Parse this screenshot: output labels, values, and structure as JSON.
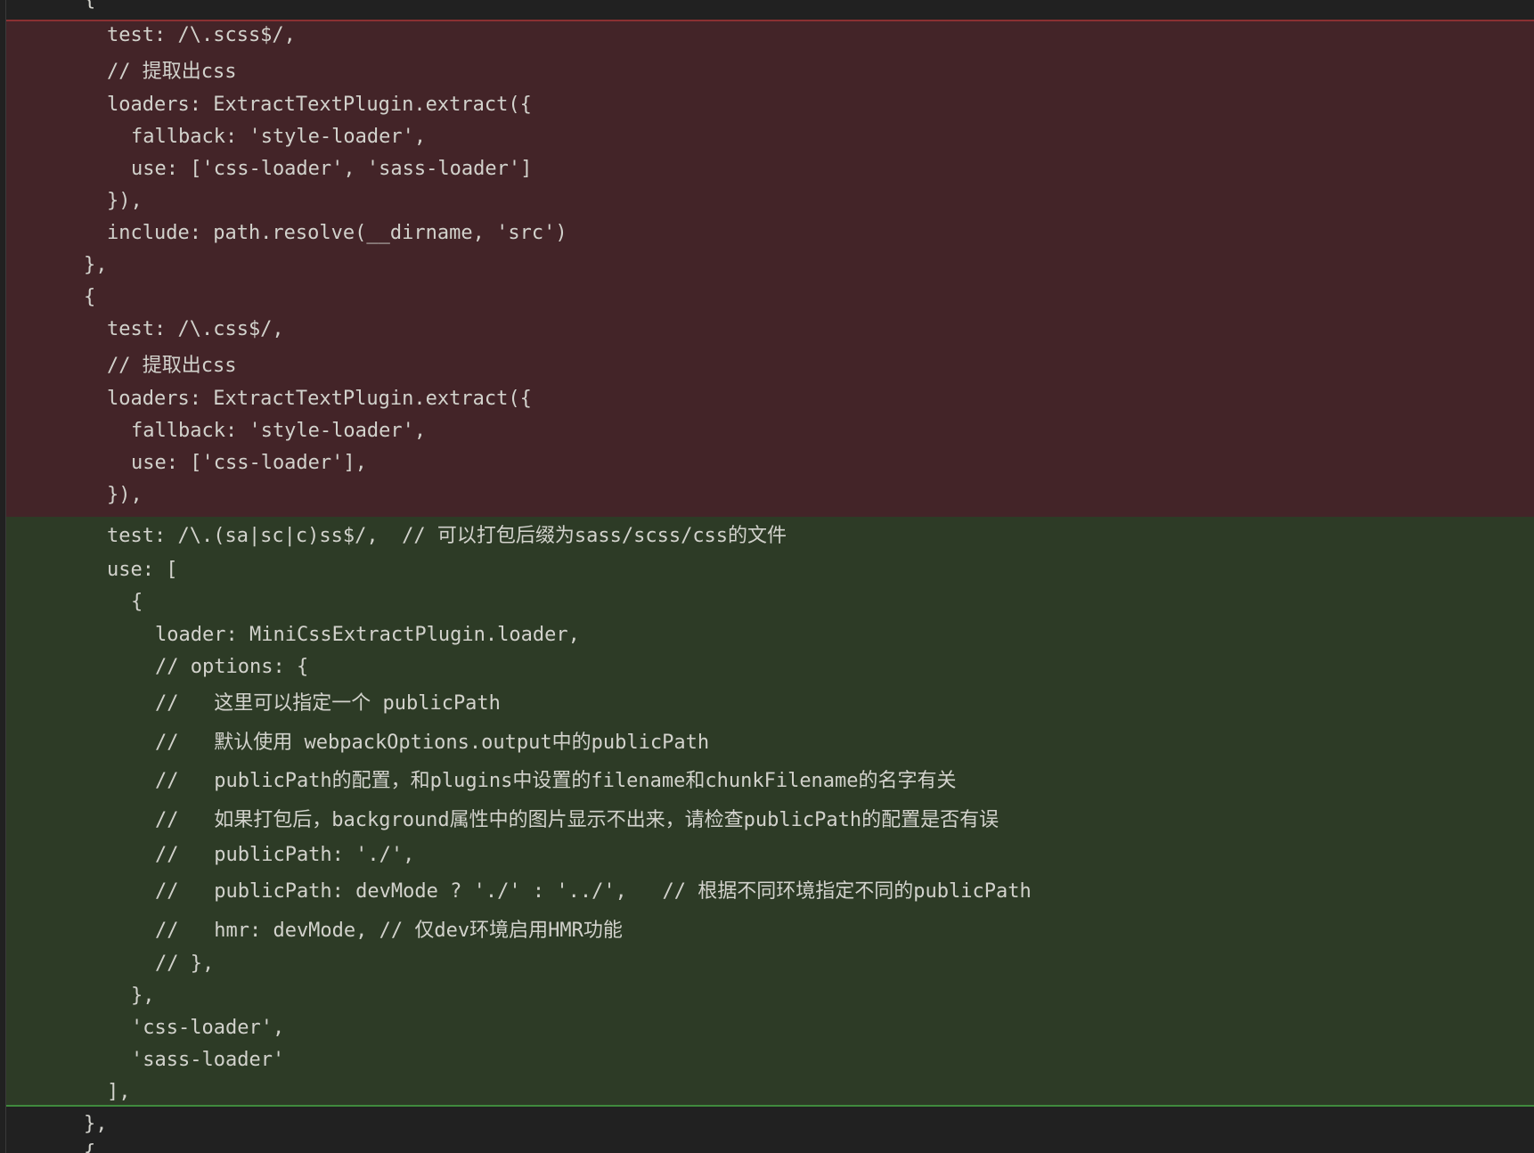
{
  "editor": {
    "context_top": [
      "{"
    ],
    "removed_lines": [
      {
        "indent": 2,
        "text": "test: /\\.scss$/,"
      },
      {
        "indent": 2,
        "text": "// 提取出css"
      },
      {
        "indent": 2,
        "text": "loaders: ExtractTextPlugin.extract({"
      },
      {
        "indent": 3,
        "text": "fallback: 'style-loader',"
      },
      {
        "indent": 3,
        "text": "use: ['css-loader', 'sass-loader']"
      },
      {
        "indent": 2,
        "text": "}),"
      },
      {
        "indent": 2,
        "text": "include: path.resolve(__dirname, 'src')"
      },
      {
        "indent": 1,
        "text": "},"
      },
      {
        "indent": 1,
        "text": "{"
      },
      {
        "indent": 2,
        "text": "test: /\\.css$/,"
      },
      {
        "indent": 2,
        "text": "// 提取出css"
      },
      {
        "indent": 2,
        "text": "loaders: ExtractTextPlugin.extract({"
      },
      {
        "indent": 3,
        "text": "fallback: 'style-loader',"
      },
      {
        "indent": 3,
        "text": "use: ['css-loader'],"
      },
      {
        "indent": 2,
        "text": "}),"
      }
    ],
    "added_lines": [
      {
        "indent": 2,
        "text": "test: /\\.(sa|sc|c)ss$/,  // 可以打包后缀为sass/scss/css的文件"
      },
      {
        "indent": 2,
        "text": "use: ["
      },
      {
        "indent": 3,
        "text": "{"
      },
      {
        "indent": 4,
        "text": "loader: MiniCssExtractPlugin.loader,"
      },
      {
        "indent": 4,
        "text": "// options: {"
      },
      {
        "indent": 4,
        "text": "//   这里可以指定一个 publicPath"
      },
      {
        "indent": 4,
        "text": "//   默认使用 webpackOptions.output中的publicPath"
      },
      {
        "indent": 4,
        "text": "//   publicPath的配置，和plugins中设置的filename和chunkFilename的名字有关"
      },
      {
        "indent": 4,
        "text": "//   如果打包后，background属性中的图片显示不出来，请检查publicPath的配置是否有误"
      },
      {
        "indent": 4,
        "text": "//   publicPath: './',"
      },
      {
        "indent": 4,
        "text": "//   publicPath: devMode ? './' : '../',   // 根据不同环境指定不同的publicPath"
      },
      {
        "indent": 4,
        "text": "//   hmr: devMode, // 仅dev环境启用HMR功能"
      },
      {
        "indent": 4,
        "text": "// },"
      },
      {
        "indent": 3,
        "text": "},"
      },
      {
        "indent": 3,
        "text": "'css-loader',"
      },
      {
        "indent": 3,
        "text": "'sass-loader'"
      },
      {
        "indent": 2,
        "text": "],"
      }
    ],
    "context_bottom": [
      "},",
      "{"
    ],
    "colors": {
      "background": "#212121",
      "removed_bg": "#432428",
      "added_bg": "#2d3b26",
      "text": "#d2d2cc"
    }
  }
}
